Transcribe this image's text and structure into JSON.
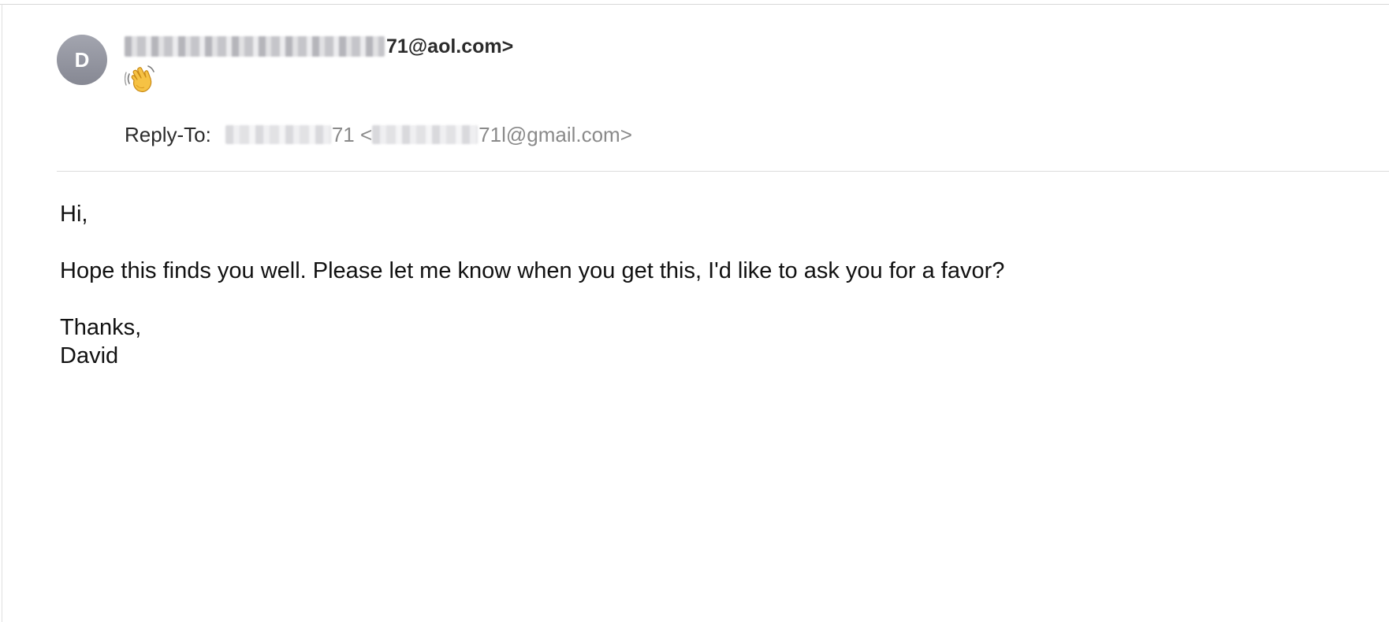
{
  "header": {
    "avatar_initial": "D",
    "from_suffix": "71@aol.com>",
    "subject_icon": "waving-hand-icon",
    "reply_to_label": "Reply-To:",
    "reply_to_name_suffix": "71 <",
    "reply_to_email_suffix": "71l@gmail.com>"
  },
  "body": {
    "greeting": "Hi,",
    "message": "Hope this finds you well. Please let me know when you get this, I'd like to ask you for a favor?",
    "signoff": "Thanks,",
    "signature": "David"
  }
}
